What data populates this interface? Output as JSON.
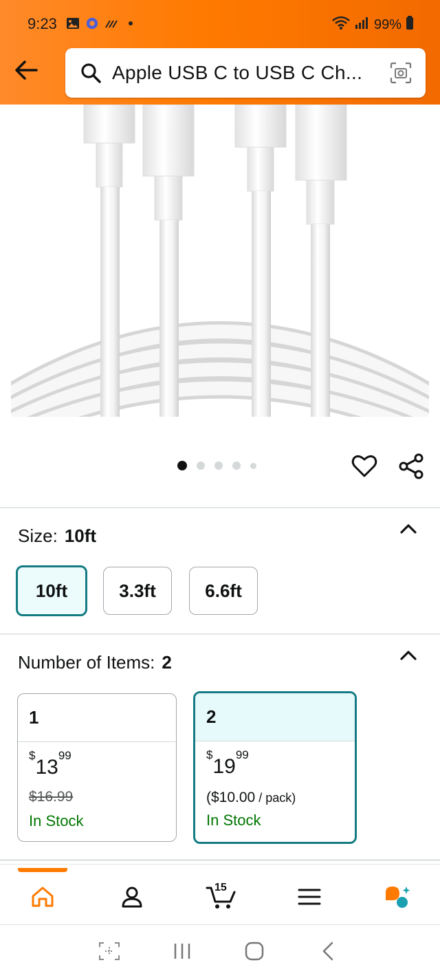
{
  "status_bar": {
    "time": "9:23",
    "battery": "99%"
  },
  "search": {
    "query": "Apple USB C to USB C Ch..."
  },
  "carousel": {
    "active_index": 0,
    "count": 5
  },
  "size": {
    "label": "Size:",
    "selected": "10ft",
    "options": [
      "10ft",
      "3.3ft",
      "6.6ft"
    ]
  },
  "items": {
    "label": "Number of Items:",
    "selected": "2",
    "options": [
      {
        "count": "1",
        "currency": "$",
        "price_whole": "13",
        "price_fraction": "99",
        "list_price": "$16.99",
        "stock": "In Stock"
      },
      {
        "count": "2",
        "currency": "$",
        "price_whole": "19",
        "price_fraction": "99",
        "per_unit": "($10.00",
        "per_unit_suffix": " / pack)",
        "stock": "In Stock"
      }
    ]
  },
  "bottom_nav": {
    "cart_count": "15"
  },
  "colors": {
    "header": "#ff7a00",
    "selected_border": "#147b82",
    "in_stock": "#007600"
  }
}
